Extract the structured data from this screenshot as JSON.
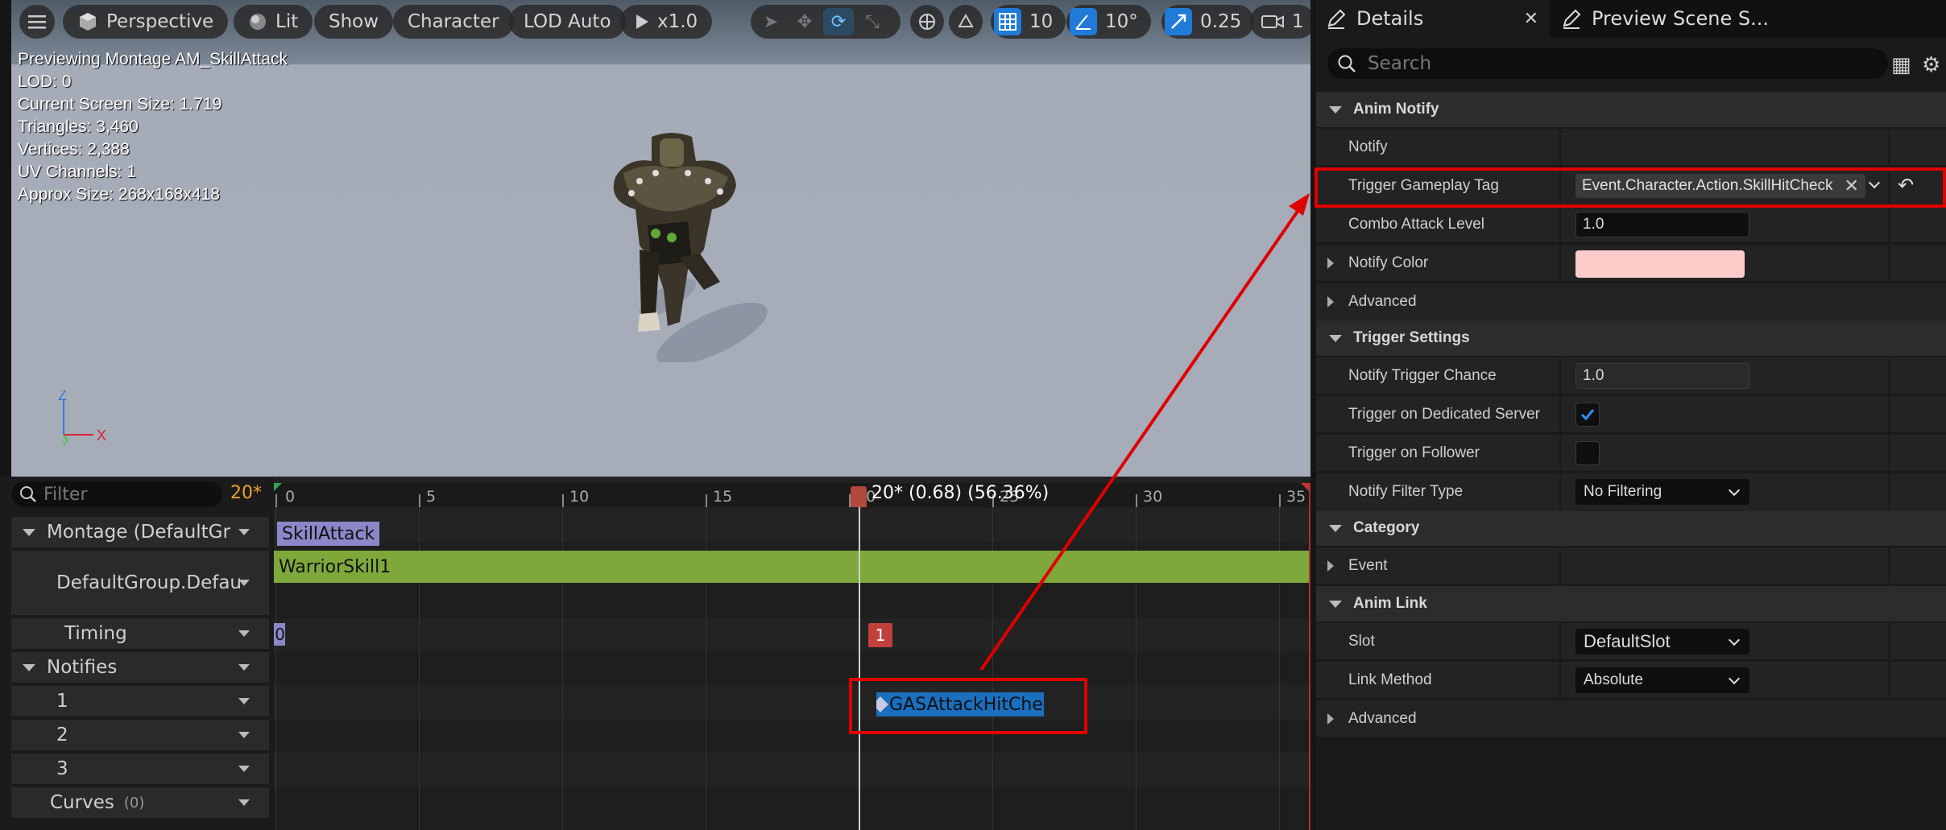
{
  "viewport": {
    "toolbar": {
      "perspective": "Perspective",
      "lit": "Lit",
      "show": "Show",
      "character": "Character",
      "lod": "LOD Auto",
      "play_speed": "x1.0",
      "grid_size": "10",
      "rotation_snap": "10°",
      "scale_snap": "0.25",
      "camera_speed": "1"
    },
    "info": [
      "Previewing Montage AM_SkillAttack",
      "LOD: 0",
      "Current Screen Size: 1.719",
      "Triangles: 3,460",
      "Vertices: 2,388",
      "UV Channels: 1",
      "Approx Size: 268x168x418"
    ],
    "axis": {
      "z": "Z",
      "x": "X",
      "y": "Y"
    }
  },
  "timeline": {
    "filter_placeholder": "Filter",
    "current_frame": "20*",
    "playhead_label": "20* (0.68) (56.36%)",
    "ticks": [
      "0",
      "5",
      "10",
      "15",
      "20",
      "25",
      "30",
      "35"
    ],
    "tracks": {
      "montage": "Montage (DefaultGr",
      "default_group": "DefaultGroup.Defau",
      "timing": "Timing",
      "notifies": "Notifies",
      "notify_1": "1",
      "notify_2": "2",
      "notify_3": "3",
      "curves": "Curves",
      "curves_count": "(0)"
    },
    "segments": {
      "montage_section": "SkillAttack",
      "slot_anim": "WarriorSkill1",
      "timing_left": "0",
      "timing_marker": "1",
      "notify": "GASAttackHitCheck"
    }
  },
  "details": {
    "tabs": {
      "details": "Details",
      "preview": "Preview Scene S..."
    },
    "search_placeholder": "Search",
    "categories": {
      "anim_notify": "Anim Notify",
      "trigger_settings": "Trigger Settings",
      "category": "Category",
      "anim_link": "Anim Link"
    },
    "props": {
      "notify": "Notify",
      "trigger_gameplay_tag": "Trigger Gameplay Tag",
      "trigger_gameplay_tag_value": "Event.Character.Action.SkillHitCheck",
      "combo_attack_level": "Combo Attack Level",
      "combo_attack_level_value": "1.0",
      "notify_color": "Notify Color",
      "notify_color_value": "#ffcccc",
      "advanced": "Advanced",
      "notify_trigger_chance": "Notify Trigger Chance",
      "notify_trigger_chance_value": "1.0",
      "trigger_on_dedicated_server": "Trigger on Dedicated Server",
      "trigger_on_follower": "Trigger on Follower",
      "notify_filter_type": "Notify Filter Type",
      "notify_filter_type_value": "No Filtering",
      "event": "Event",
      "slot": "Slot",
      "slot_value": "DefaultSlot",
      "link_method": "Link Method",
      "link_method_value": "Absolute",
      "advanced2": "Advanced"
    },
    "checks": {
      "dedicated_server": true,
      "follower": false
    }
  },
  "colors": {
    "accent": "#1f7ad8",
    "highlight_red": "#e00000",
    "montage_section": "#8b87c9",
    "slot_anim": "#7ea83a",
    "notify_bg": "#1a6fbf",
    "timing_marker": "#c0403c"
  }
}
